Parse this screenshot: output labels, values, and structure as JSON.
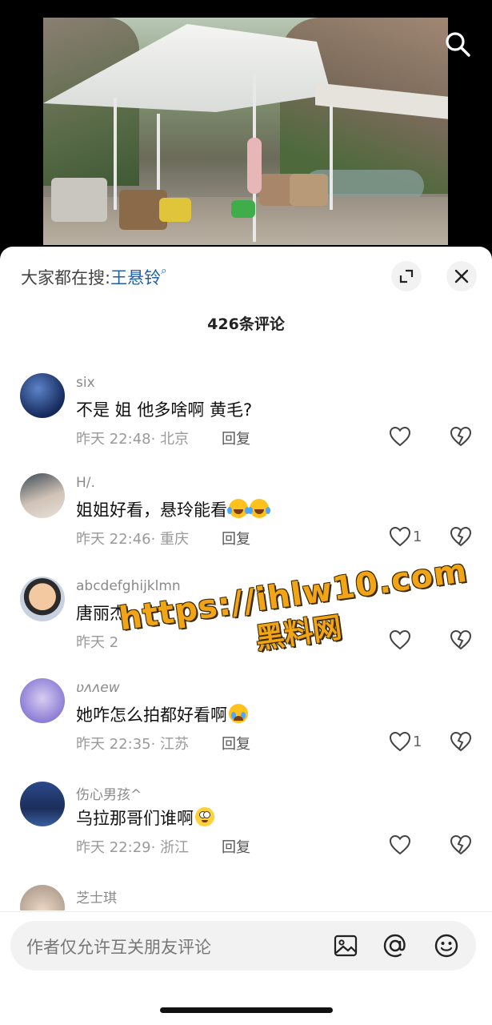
{
  "hot_search": {
    "prefix": "大家都在搜:",
    "keyword": "王悬铃"
  },
  "comment_count": "426条评论",
  "comments": [
    {
      "user": "six",
      "text": "不是 姐 他多啥啊 黄毛?",
      "time": "昨天 22:48",
      "location": "· 北京",
      "reply": "回复",
      "likes": ""
    },
    {
      "user": "H/.",
      "text": "姐姐好看，悬玲能看",
      "time": "昨天 22:46",
      "location": "· 重庆",
      "reply": "回复",
      "likes": "1"
    },
    {
      "user": "abcdefghijklmn",
      "text": "唐丽杰",
      "time": "昨天 2",
      "location": "",
      "reply": "",
      "likes": ""
    },
    {
      "user": "ʋʌʌew",
      "text": "她咋怎么拍都好看啊",
      "time": "昨天 22:35",
      "location": "· 江苏",
      "reply": "回复",
      "likes": "1"
    },
    {
      "user": "伤心男孩^",
      "text": "乌拉那哥们谁啊",
      "time": "昨天 22:29",
      "location": "· 浙江",
      "reply": "回复",
      "likes": ""
    },
    {
      "user": "芝士琪",
      "text": "",
      "time": "",
      "location": "",
      "reply": "",
      "likes": ""
    }
  ],
  "input": {
    "placeholder": "作者仅允许互关朋友评论"
  },
  "watermark": {
    "line1": "https://ihlw10.com",
    "line2": "黑料网"
  },
  "icons": [
    "search-icon",
    "expand-icon",
    "close-icon",
    "heart-icon",
    "broken-heart-icon",
    "image-icon",
    "at-icon",
    "emoji-icon"
  ],
  "colors": {
    "keyword": "#1f5fa8",
    "watermark": "#f0a416"
  }
}
